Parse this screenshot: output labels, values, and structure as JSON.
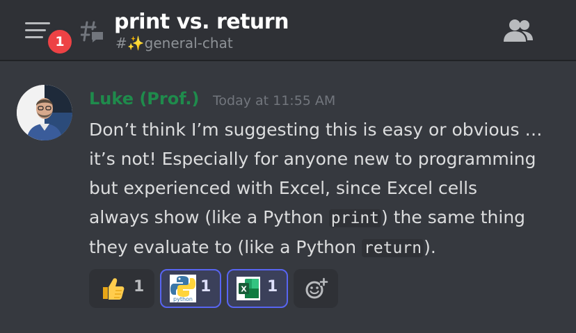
{
  "header": {
    "notification_count": "1",
    "title": "print vs. return",
    "channel": "#✨general-chat"
  },
  "message": {
    "author": "Luke (Prof.)",
    "timestamp": "Today at 11:55 AM",
    "lines": [
      {
        "text": "Don’t think I’m suggesting this is easy or obvious …"
      },
      {
        "text": "it’s not! Especially for anyone new to programming"
      },
      {
        "text": "but experienced with Excel, since Excel cells"
      },
      {
        "pre": "always show (like a Python ",
        "code": "print",
        "post": ") the same thing"
      },
      {
        "pre": "they evaluate to (like a Python ",
        "code": "return",
        "post": ")."
      }
    ]
  },
  "reactions": [
    {
      "emoji": "thumbs-up",
      "count": "1",
      "active": false
    },
    {
      "emoji": "python-logo",
      "label": "python",
      "count": "1",
      "active": true
    },
    {
      "emoji": "excel-logo",
      "label": "X",
      "count": "1",
      "active": true
    }
  ],
  "colors": {
    "background": "#36393f",
    "header": "#2f3136",
    "author": "#1f8b4c",
    "badge": "#ed4245",
    "reaction_active_border": "#5865f2"
  }
}
